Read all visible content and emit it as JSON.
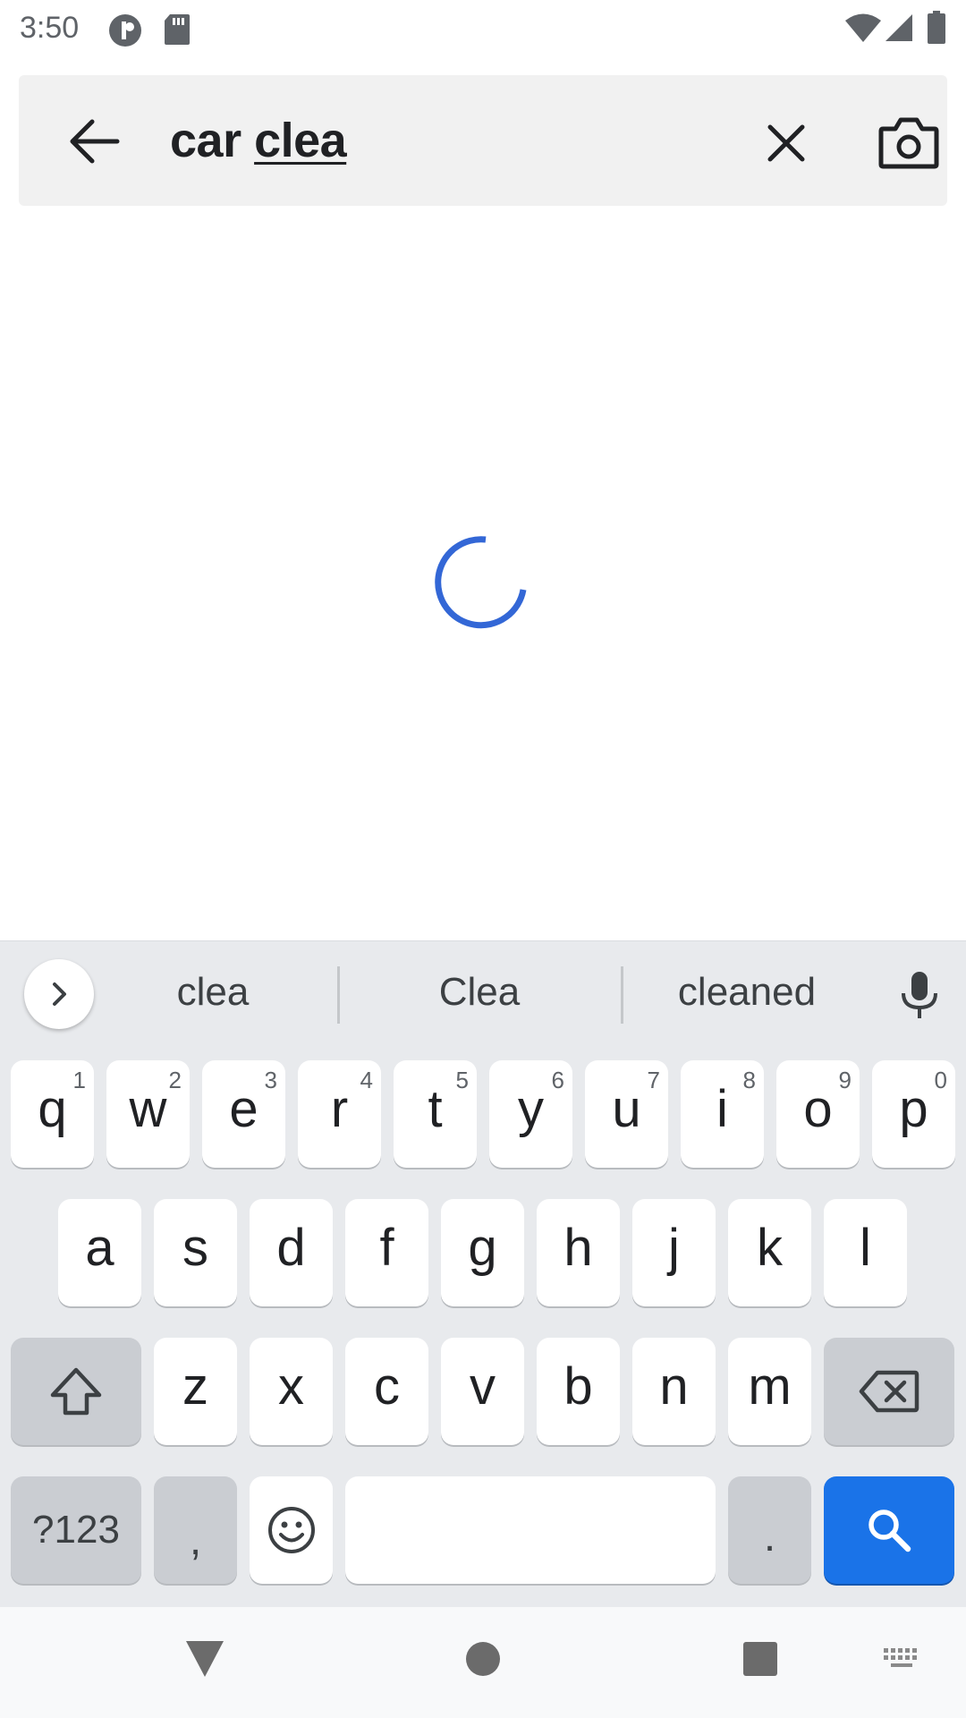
{
  "status_bar": {
    "time": "3:50",
    "icons": [
      "data-saver-icon",
      "sd-card-icon",
      "wifi-icon",
      "cell-signal-icon",
      "battery-icon"
    ]
  },
  "search_bar": {
    "query_prefix": "car ",
    "query_composing": "clea",
    "icons": [
      "back-arrow-icon",
      "clear-icon",
      "camera-icon"
    ]
  },
  "loading": {
    "indicator": "loading-spinner",
    "color": "#3367d6"
  },
  "keyboard": {
    "suggestions": [
      "clea",
      "Clea",
      "cleaned"
    ],
    "row1": [
      {
        "label": "q",
        "hint": "1"
      },
      {
        "label": "w",
        "hint": "2"
      },
      {
        "label": "e",
        "hint": "3"
      },
      {
        "label": "r",
        "hint": "4"
      },
      {
        "label": "t",
        "hint": "5"
      },
      {
        "label": "y",
        "hint": "6"
      },
      {
        "label": "u",
        "hint": "7"
      },
      {
        "label": "i",
        "hint": "8"
      },
      {
        "label": "o",
        "hint": "9"
      },
      {
        "label": "p",
        "hint": "0"
      }
    ],
    "row2": [
      "a",
      "s",
      "d",
      "f",
      "g",
      "h",
      "j",
      "k",
      "l"
    ],
    "row3": [
      "z",
      "x",
      "c",
      "v",
      "b",
      "n",
      "m"
    ],
    "symbols_key": "?123",
    "comma_key": ",",
    "period_key": ".",
    "accent_color": "#1a73e8"
  },
  "nav_bar": {
    "icons": [
      "back-triangle-icon",
      "home-circle-icon",
      "recents-square-icon",
      "keyboard-switch-icon"
    ]
  }
}
